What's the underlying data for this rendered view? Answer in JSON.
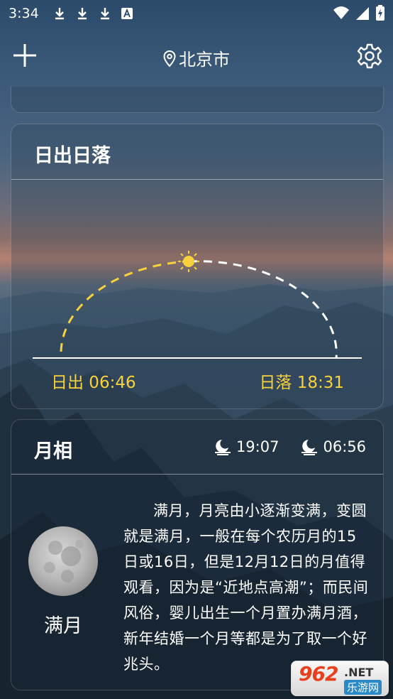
{
  "status_bar": {
    "time": "3:34"
  },
  "header": {
    "location": "北京市"
  },
  "sun_card": {
    "title": "日出日落",
    "sunrise_label": "日出 06:46",
    "sunset_label": "日落 18:31",
    "day_progress": 0.5
  },
  "moon_card": {
    "title": "月相",
    "moonrise": "19:07",
    "moonset": "06:56",
    "phase_name": "满月",
    "description": "满月，月亮由小逐渐变满，变圆就是满月，一般在每个农历月的15日或16日，但是12月12日的月值得观看，因为是“近地点高潮”；而民间风俗，婴儿出生一个月置办满月酒，新年结婚一个月等都是为了取一个好兆头。"
  },
  "watermark": {
    "number": "962",
    "suffix": ".NET",
    "subtitle": "乐游网"
  },
  "colors": {
    "accent": "#f7d23a",
    "divider": "#ffffff"
  }
}
